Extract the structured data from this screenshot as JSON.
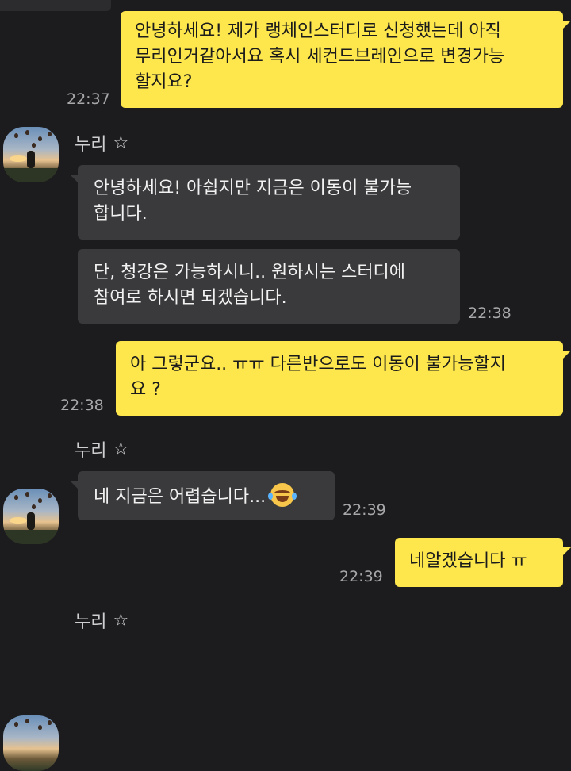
{
  "chat": {
    "messages": [
      {
        "sender": "me",
        "text": "안녕하세요! 제가 랭체인스터디로 신청했는데 아직\n무리인거같아서요 혹시 세컨드브레인으로 변경가능\n할지요?",
        "time": "22:37"
      },
      {
        "sender": "other",
        "name": "누리",
        "texts": [
          "안녕하세요! 아쉽지만 지금은 이동이 불가능\n합니다.",
          "단, 청강은 가능하시니.. 원하시는 스터디에\n참여로 하시면 되겠습니다."
        ],
        "time": "22:38"
      },
      {
        "sender": "me",
        "text": "아 그렇군요.. ㅠㅠ 다른반으로도 이동이 불가능할지\n요 ?",
        "time": "22:38"
      },
      {
        "sender": "other",
        "name": "누리",
        "texts": [
          "네 지금은 어렵습니다..."
        ],
        "emoji": "laughing-with-tears",
        "time": "22:39"
      },
      {
        "sender": "me",
        "text": "네알겠습니다 ㅠ",
        "time": "22:39"
      },
      {
        "sender": "other",
        "name": "누리"
      }
    ],
    "star_icon": "☆"
  }
}
